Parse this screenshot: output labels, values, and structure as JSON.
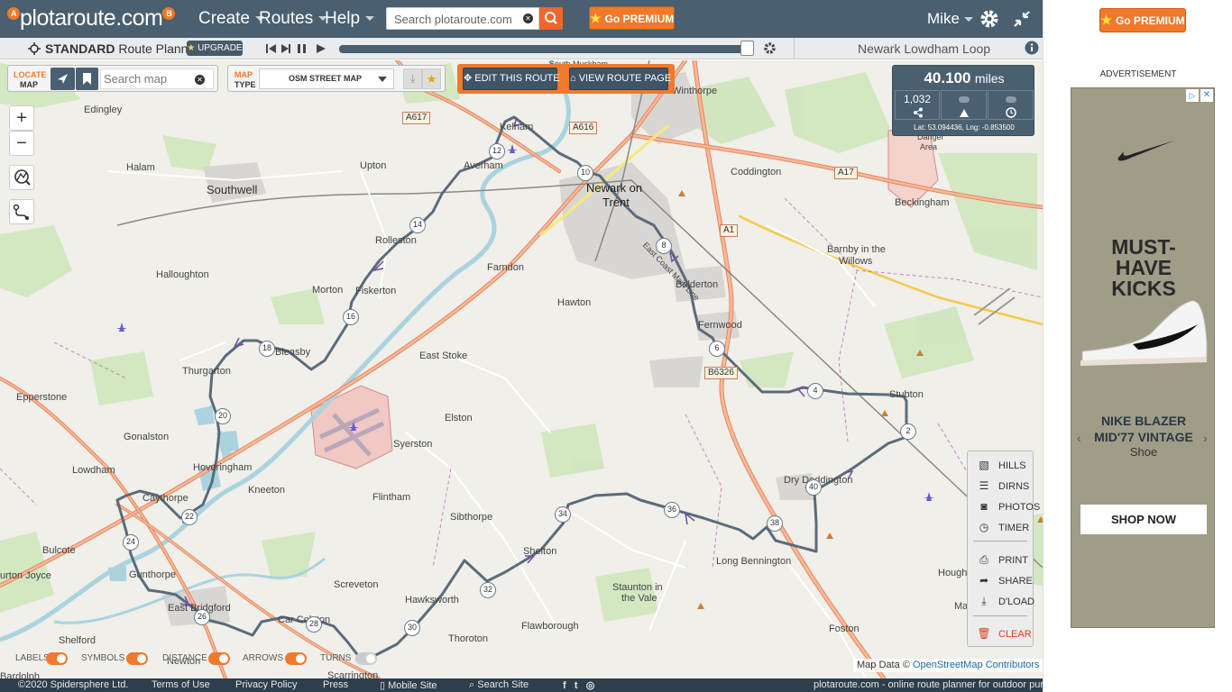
{
  "header": {
    "logo_text": "plotaroute.com",
    "logo_pin_a": "A",
    "logo_pin_b": "B",
    "menus": [
      {
        "label": "Create"
      },
      {
        "label": "Routes"
      },
      {
        "label": "Help"
      }
    ],
    "search_placeholder": "Search plotaroute.com",
    "premium_label": "Go PREMIUM",
    "user_name": "Mike"
  },
  "subbar": {
    "planner_mode": "STANDARD",
    "planner_suffix": "Route Planner",
    "upgrade_label": "UPGRADE",
    "route_title": "Newark Lowdham Loop"
  },
  "map_panel": {
    "locate_label_1": "LOCATE",
    "locate_label_2": "MAP",
    "search_map_placeholder": "Search map",
    "maptype_label_1": "MAP",
    "maptype_label_2": "TYPE",
    "maptype_selected": "OSM STREET MAP",
    "edit_route_label": "EDIT THIS ROUTE",
    "view_route_label": "VIEW ROUTE PAGE"
  },
  "stats": {
    "distance_value": "40.100",
    "distance_unit": "miles",
    "share_count": "1,032",
    "coords": "Lat: 53.094436, Lng: -0.853500"
  },
  "tools": [
    {
      "label": "HILLS",
      "icon": "image-icon"
    },
    {
      "label": "DIRNS",
      "icon": "list-icon"
    },
    {
      "label": "PHOTOS",
      "icon": "camera-icon"
    },
    {
      "label": "TIMER",
      "icon": "clock-icon"
    },
    {
      "label": "PRINT",
      "icon": "printer-icon"
    },
    {
      "label": "SHARE",
      "icon": "share-icon"
    },
    {
      "label": "D'LOAD",
      "icon": "download-icon"
    },
    {
      "label": "CLEAR",
      "icon": "trash-icon"
    }
  ],
  "toggles": [
    {
      "label": "LABELS",
      "on": true
    },
    {
      "label": "SYMBOLS",
      "on": true
    },
    {
      "label": "DISTANCE",
      "on": true
    },
    {
      "label": "ARROWS",
      "on": true
    },
    {
      "label": "TURNS",
      "on": false
    }
  ],
  "attribution": {
    "prefix": "Map Data ©",
    "link": "OpenStreetMap Contributors"
  },
  "map_labels": {
    "places": [
      "Edingley",
      "Halam",
      "Southwell",
      "Upton",
      "Averham",
      "Kelham",
      "Newark on",
      "Trent",
      "Coddington",
      "Beckingham",
      "Rolleston",
      "Farndon",
      "Barnby in the",
      "Willows",
      "Halloughton",
      "Morton",
      "Fiskerton",
      "Balderton",
      "Hawton",
      "Fernwood",
      "Thurgarton",
      "Bleasby",
      "East Stoke",
      "Stubton",
      "Epperstone",
      "Elston",
      "Gonalston",
      "Syerston",
      "Lowdham",
      "Caythorpe",
      "Hoveringham",
      "Kneeton",
      "Flintham",
      "Dry Doddington",
      "Sibthorpe",
      "Bulcote",
      "Gunthorpe",
      "Shelton",
      "Long Bennington",
      "urton Joyce",
      "Screveton",
      "Hawksworth",
      "Staunton in",
      "the Vale",
      "East Bridgford",
      "Car Colston",
      "Flawborough",
      "Foston",
      "Shelford",
      "Newton",
      "Thoroton",
      "Scarrington",
      "Hough",
      "Ma",
      "Bardolph",
      "South Muskham",
      "Danger",
      "Area",
      "Winthorpe",
      "East Coast Main Line"
    ],
    "roads": [
      "A617",
      "A616",
      "A17",
      "A1",
      "B6326"
    ]
  },
  "route_markers": [
    "2",
    "4",
    "6",
    "8",
    "10",
    "12",
    "14",
    "16",
    "18",
    "20",
    "22",
    "24",
    "26",
    "28",
    "30",
    "32",
    "34",
    "36",
    "38",
    "40"
  ],
  "footer": {
    "copyright": "©2020 Spidersphere Ltd.",
    "links": [
      "Terms of Use",
      "Privacy Policy",
      "Press",
      "Mobile Site",
      "Search Site"
    ],
    "tagline": "plotaroute.com - online route planner for outdoor pursuits"
  },
  "sidebar": {
    "premium_label": "Go PREMIUM",
    "ad_label": "ADVERTISEMENT",
    "ad": {
      "headline_1": "MUST-",
      "headline_2": "HAVE",
      "headline_3": "KICKS",
      "product_1": "NIKE BLAZER",
      "product_2": "MID'77 VINTAGE",
      "product_type": "Shoe",
      "cta": "SHOP NOW"
    }
  }
}
